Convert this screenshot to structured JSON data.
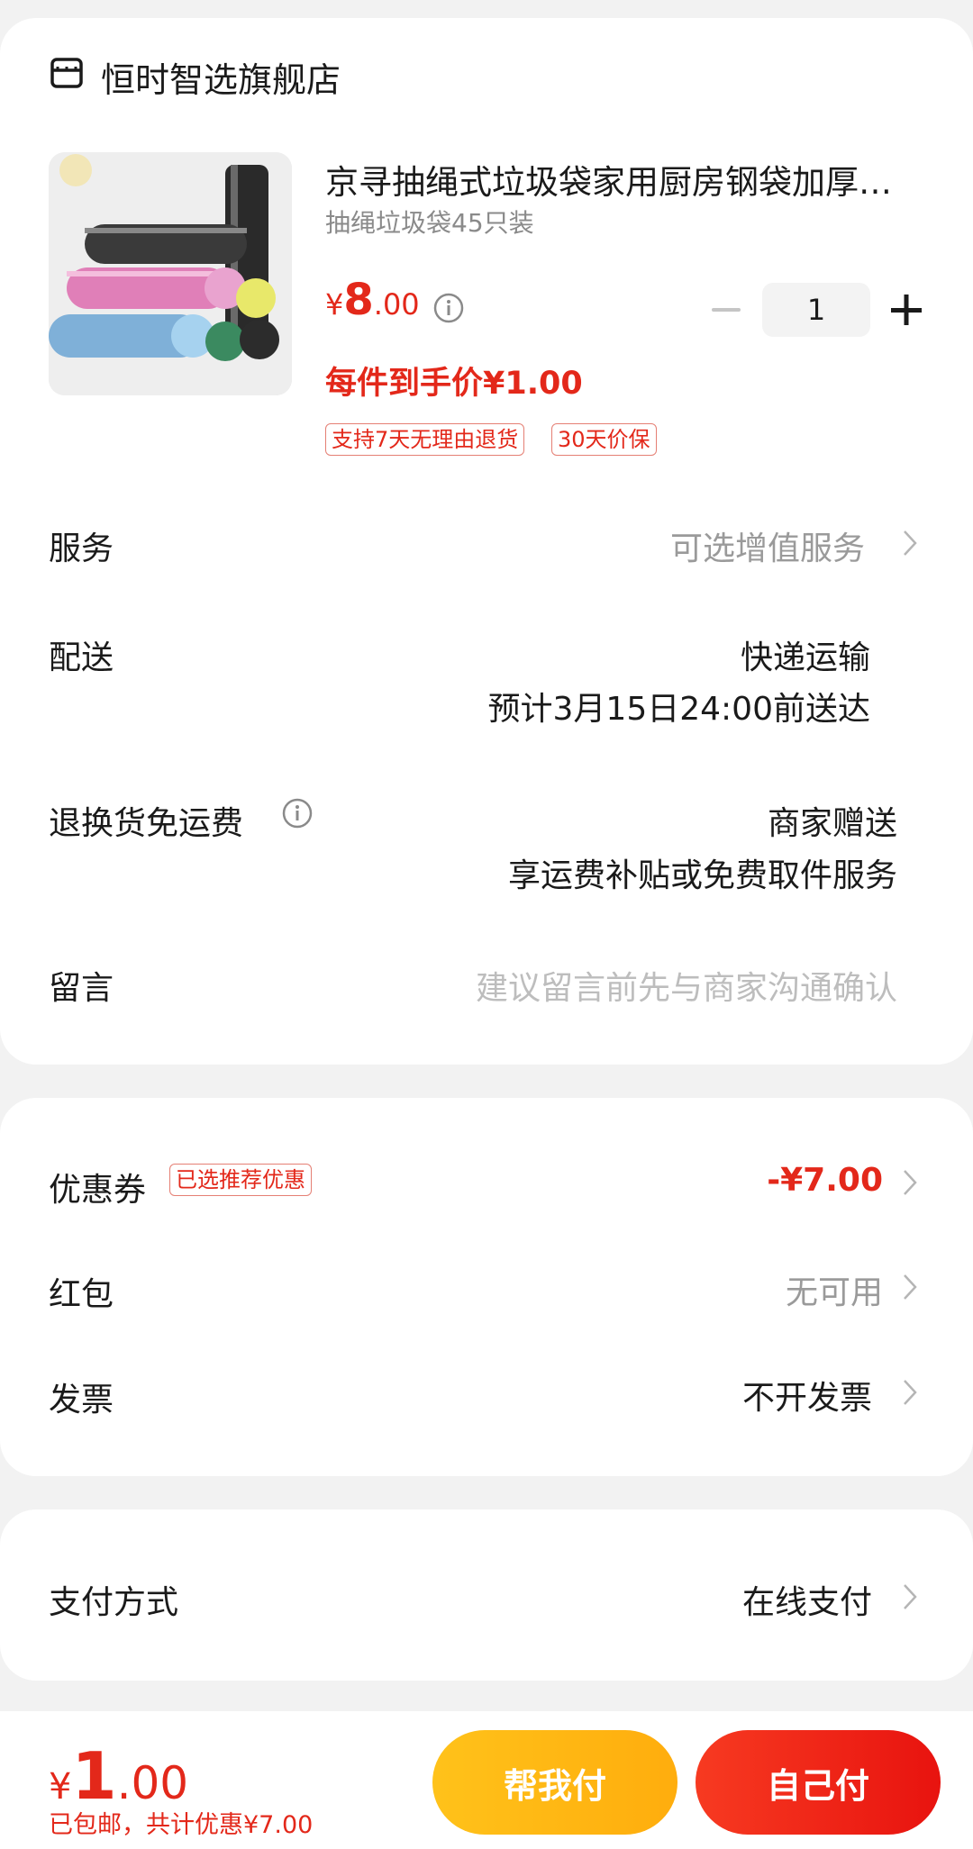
{
  "store": {
    "name": "恒时智选旗舰店",
    "icon": "store-icon"
  },
  "product": {
    "title": "京寻抽绳式垃圾袋家用厨房钢袋加厚…",
    "spec": "抽绳垃圾袋45只装",
    "price_symbol": "¥",
    "price_int": "8",
    "price_dec": ".00",
    "quantity": "1",
    "unit_price": "每件到手价¥1.00",
    "tags": [
      "支持7天无理由退货",
      "30天价保"
    ]
  },
  "rows": {
    "service": {
      "label": "服务",
      "value": "可选增值服务"
    },
    "delivery": {
      "label": "配送",
      "value": "快递运输",
      "value2": "预计3月15日24:00前送达"
    },
    "return_freight": {
      "label": "退换货免运费",
      "value": "商家赠送",
      "value2": "享运费补贴或免费取件服务"
    },
    "message": {
      "label": "留言",
      "placeholder": "建议留言前先与商家沟通确认"
    }
  },
  "discounts": {
    "coupon": {
      "label": "优惠券",
      "tag": "已选推荐优惠",
      "value": "-¥7.00"
    },
    "red_packet": {
      "label": "红包",
      "value": "无可用"
    },
    "invoice": {
      "label": "发票",
      "value": "不开发票"
    }
  },
  "payment": {
    "label": "支付方式",
    "value": "在线支付"
  },
  "footer": {
    "total_symbol": "¥",
    "total_int": "1",
    "total_dec": ".00",
    "note": "已包邮，共计优惠¥7.00",
    "help_pay": "帮我付",
    "self_pay": "自己付"
  },
  "colors": {
    "accent_red": "#e3281a",
    "button_yellow": "#ffb814",
    "button_red": "#f0241a"
  }
}
